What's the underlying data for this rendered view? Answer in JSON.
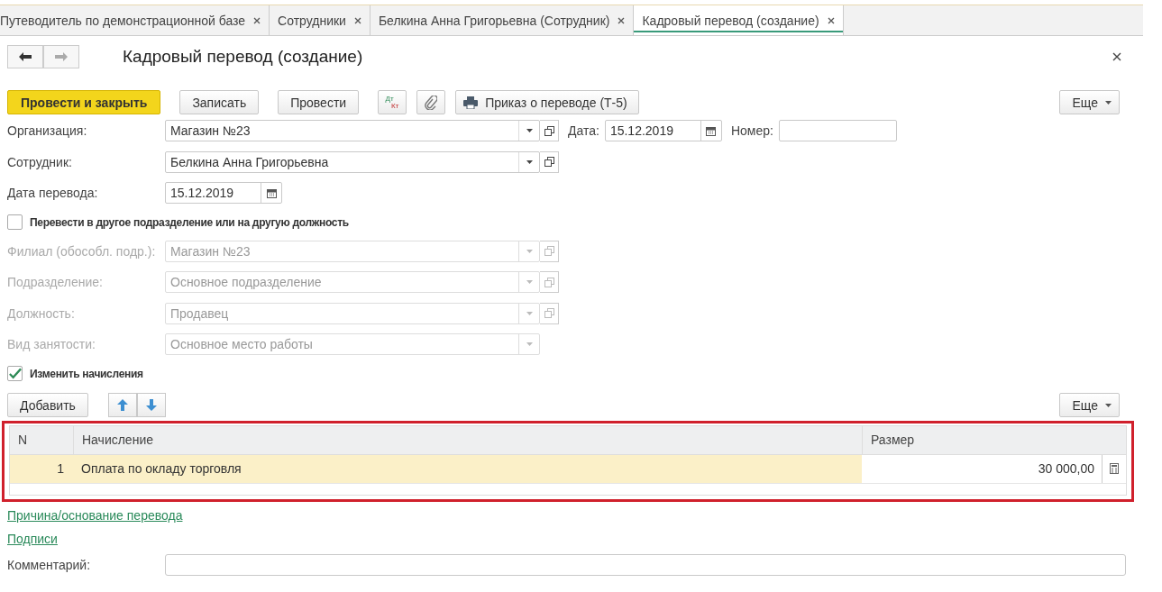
{
  "tabs": [
    {
      "label": "Путеводитель по демонстрационной базе",
      "selected": false
    },
    {
      "label": "Сотрудники",
      "selected": false
    },
    {
      "label": "Белкина Анна Григорьевна (Сотрудник)",
      "selected": false
    },
    {
      "label": "Кадровый перевод (создание)",
      "selected": true
    }
  ],
  "header": {
    "title": "Кадровый перевод (создание)"
  },
  "toolbar": [
    {
      "kind": "primary",
      "label": "Провести и закрыть"
    },
    {
      "kind": "plain",
      "label": "Записать"
    },
    {
      "kind": "plain",
      "label": "Провести"
    },
    {
      "kind": "dtkt",
      "top": "Дт",
      "bottom": "Кт"
    },
    {
      "kind": "clip"
    },
    {
      "kind": "print",
      "label": "Приказ о переводе (Т-5)"
    },
    {
      "kind": "more",
      "label": "Еще"
    }
  ],
  "form": [
    {
      "kind": "field",
      "label": "Организация:",
      "value": "Магазин №23",
      "disabled": false,
      "dropdown": true,
      "open": true,
      "date_label": "Дата:",
      "date": "15.12.2019",
      "number_label": "Номер:"
    },
    {
      "kind": "field",
      "label": "Сотрудник:",
      "value": "Белкина Анна Григорьевна",
      "disabled": false,
      "dropdown": true,
      "open": true
    },
    {
      "kind": "date",
      "label": "Дата перевода:",
      "value": "15.12.2019"
    },
    {
      "kind": "checkbox",
      "label": "Перевести в другое подразделение или на другую должность",
      "checked": false
    },
    {
      "kind": "field",
      "label": "Филиал (обособл. подр.):",
      "value": "Магазин №23",
      "disabled": true,
      "dropdown": true,
      "open": true
    },
    {
      "kind": "field",
      "label": "Подразделение:",
      "value": "Основное подразделение",
      "disabled": true,
      "dropdown": true,
      "open": true
    },
    {
      "kind": "field",
      "label": "Должность:",
      "value": "Продавец",
      "disabled": true,
      "dropdown": true,
      "open": true
    },
    {
      "kind": "field",
      "label": "Вид занятости:",
      "value": "Основное место работы",
      "disabled": true,
      "dropdown": true,
      "open": false
    },
    {
      "kind": "checkbox",
      "label": "Изменить начисления",
      "checked": true
    }
  ],
  "table_toolbar": {
    "add": "Добавить",
    "more": "Еще"
  },
  "table": {
    "highlighted": true,
    "columns": [
      "N",
      "Начисление",
      "Размер"
    ],
    "rows": [
      {
        "n": "1",
        "accrual": "Оплата по окладу торговля",
        "amount": "30 000,00",
        "selected": true
      }
    ]
  },
  "links": [
    "Причина/основание перевода",
    "Подписи"
  ],
  "comment": {
    "label": "Комментарий:"
  }
}
